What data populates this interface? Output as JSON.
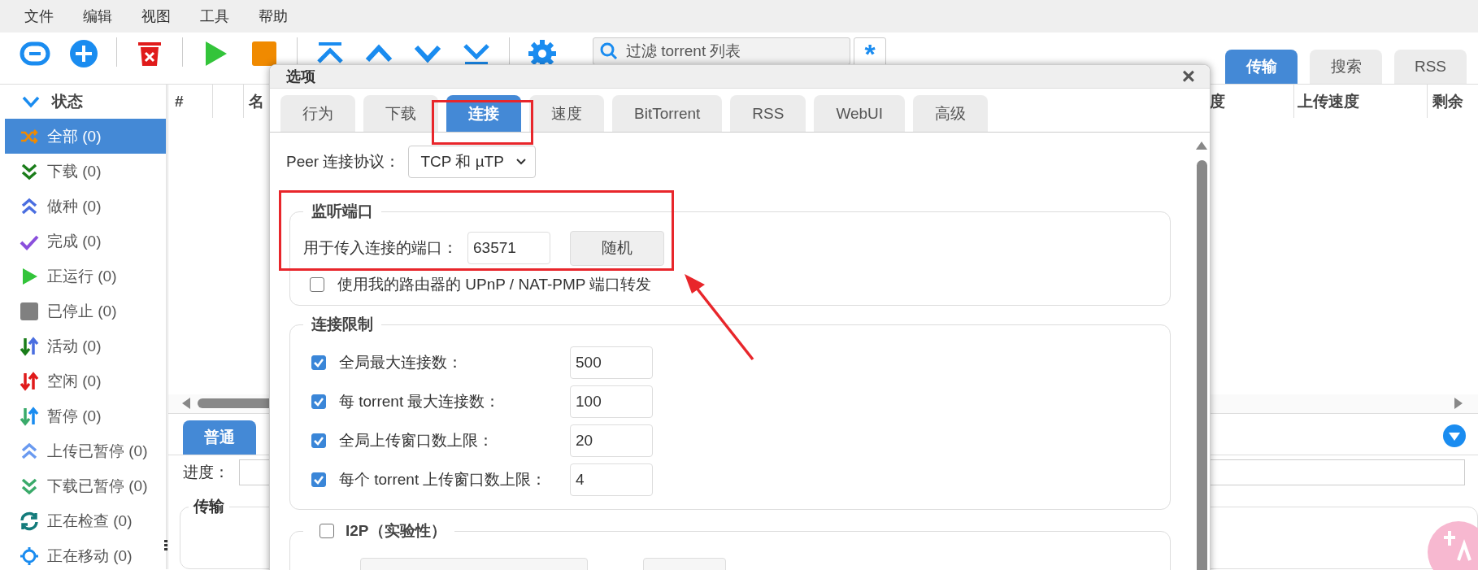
{
  "menu": [
    "文件",
    "编辑",
    "视图",
    "工具",
    "帮助"
  ],
  "toolbar": {
    "buttons": [
      {
        "kind": "link"
      },
      {
        "kind": "add"
      },
      {
        "kind": "sep"
      },
      {
        "kind": "delete"
      },
      {
        "kind": "sep"
      },
      {
        "kind": "play"
      },
      {
        "kind": "stop"
      },
      {
        "kind": "sep"
      },
      {
        "kind": "top"
      },
      {
        "kind": "up"
      },
      {
        "kind": "down"
      },
      {
        "kind": "bottom"
      },
      {
        "kind": "sep"
      },
      {
        "kind": "settings"
      }
    ],
    "search": {
      "placeholder": "过滤 torrent 列表"
    },
    "regex_button": "*"
  },
  "view_tabs": [
    {
      "label": "传输",
      "selected": true
    },
    {
      "label": "搜索",
      "selected": false
    },
    {
      "label": "RSS",
      "selected": false
    }
  ],
  "sidebar": {
    "header": "状态",
    "items": [
      {
        "label": "全部 (0)",
        "kind": "all",
        "selected": true
      },
      {
        "label": "下载 (0)",
        "kind": "downloading",
        "selected": false
      },
      {
        "label": "做种 (0)",
        "kind": "seeding",
        "selected": false
      },
      {
        "label": "完成 (0)",
        "kind": "completed",
        "selected": false
      },
      {
        "label": "正运行 (0)",
        "kind": "running",
        "selected": false
      },
      {
        "label": "已停止 (0)",
        "kind": "stopped",
        "selected": false
      },
      {
        "label": "活动 (0)",
        "kind": "active",
        "selected": false
      },
      {
        "label": "空闲 (0)",
        "kind": "inactive",
        "selected": false
      },
      {
        "label": "暂停 (0)",
        "kind": "stalled",
        "selected": false
      },
      {
        "label": "上传已暂停 (0)",
        "kind": "stalled_up",
        "selected": false
      },
      {
        "label": "下载已暂停 (0)",
        "kind": "stalled_down",
        "selected": false
      },
      {
        "label": "正在检查 (0)",
        "kind": "checking",
        "selected": false
      },
      {
        "label": "正在移动 (0)",
        "kind": "moving",
        "selected": false
      }
    ]
  },
  "table": {
    "columns_left": [
      "#",
      "名"
    ],
    "columns_right": [
      "度",
      "上传速度",
      "剩余"
    ]
  },
  "details": {
    "tabs": [
      {
        "label": "普通",
        "selected": true
      }
    ],
    "progress": {
      "label": "进度：",
      "level": 0
    },
    "transfer_legend": "传输"
  },
  "dialog": {
    "title": "选项",
    "close": "×",
    "tabs": [
      {
        "label": "行为",
        "selected": false
      },
      {
        "label": "下载",
        "selected": false
      },
      {
        "label": "连接",
        "selected": true
      },
      {
        "label": "速度",
        "selected": false
      },
      {
        "label": "BitTorrent",
        "selected": false
      },
      {
        "label": "RSS",
        "selected": false
      },
      {
        "label": "WebUI",
        "selected": false
      },
      {
        "label": "高级",
        "selected": false
      }
    ],
    "peer_protocol": {
      "label": "Peer 连接协议：",
      "value": "TCP 和 µTP"
    },
    "listening_port": {
      "legend": "监听端口",
      "port_label": "用于传入连接的端口：",
      "port_value": "63571",
      "random_button": "随机",
      "upnp": {
        "label": "使用我的路由器的 UPnP / NAT-PMP 端口转发",
        "checked": false
      }
    },
    "connection_limits": {
      "legend": "连接限制",
      "rows": [
        {
          "label": "全局最大连接数：",
          "checked": true,
          "value": "500"
        },
        {
          "label": "每 torrent 最大连接数：",
          "checked": true,
          "value": "100"
        },
        {
          "label": "全局上传窗口数上限：",
          "checked": true,
          "value": "20"
        },
        {
          "label": "每个 torrent 上传窗口数上限：",
          "checked": true,
          "value": "4"
        }
      ]
    },
    "i2p": {
      "legend": "I2P（实验性）",
      "checked": false
    }
  }
}
